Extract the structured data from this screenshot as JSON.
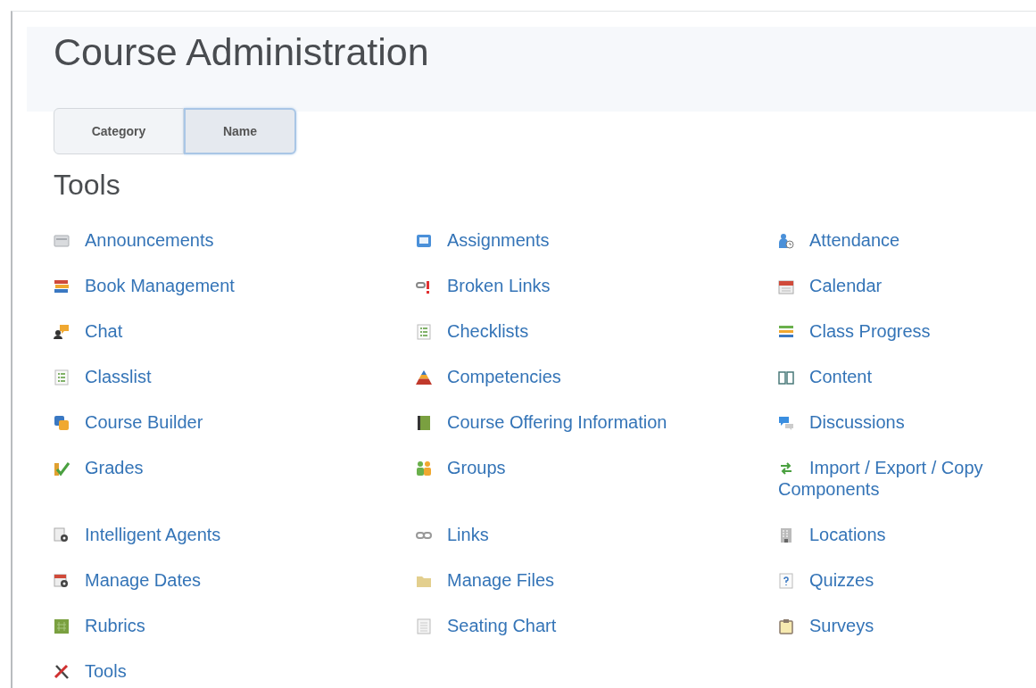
{
  "page_title": "Course Administration",
  "view_tabs": [
    {
      "label": "Category",
      "selected": false
    },
    {
      "label": "Name",
      "selected": true
    }
  ],
  "section": {
    "heading": "Tools",
    "items": [
      {
        "label": "Announcements"
      },
      {
        "label": "Assignments"
      },
      {
        "label": "Attendance"
      },
      {
        "label": "Book Management"
      },
      {
        "label": "Broken Links"
      },
      {
        "label": "Calendar"
      },
      {
        "label": "Chat"
      },
      {
        "label": "Checklists"
      },
      {
        "label": "Class Progress"
      },
      {
        "label": "Classlist"
      },
      {
        "label": "Competencies"
      },
      {
        "label": "Content"
      },
      {
        "label": "Course Builder"
      },
      {
        "label": "Course Offering Information"
      },
      {
        "label": "Discussions"
      },
      {
        "label": "Grades"
      },
      {
        "label": "Groups"
      },
      {
        "label": "Import / Export / Copy Components"
      },
      {
        "label": "Intelligent Agents"
      },
      {
        "label": "Links"
      },
      {
        "label": "Locations"
      },
      {
        "label": "Manage Dates"
      },
      {
        "label": "Manage Files"
      },
      {
        "label": "Quizzes"
      },
      {
        "label": "Rubrics"
      },
      {
        "label": "Seating Chart"
      },
      {
        "label": "Surveys"
      },
      {
        "label": "Tools"
      }
    ]
  }
}
